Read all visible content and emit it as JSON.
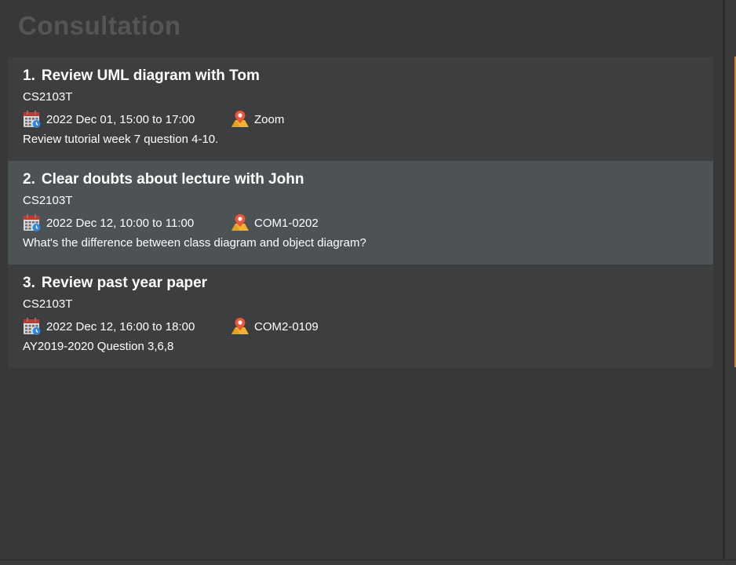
{
  "panel": {
    "title": "Consultation"
  },
  "consultations": [
    {
      "index": "1.",
      "title": "Review UML diagram with Tom",
      "module": "CS2103T",
      "datetime": "2022 Dec 01, 15:00 to 17:00",
      "location": "Zoom",
      "description": "Review tutorial week 7 question 4-10.",
      "selected": false
    },
    {
      "index": "2.",
      "title": "Clear doubts about lecture with John",
      "module": "CS2103T",
      "datetime": "2022 Dec 12, 10:00 to 11:00",
      "location": "COM1-0202",
      "description": "What's the difference between class diagram and object diagram?",
      "selected": true
    },
    {
      "index": "3.",
      "title": "Review past year paper",
      "module": "CS2103T",
      "datetime": "2022 Dec 12, 16:00 to 18:00",
      "location": "COM2-0109",
      "description": "AY2019-2020 Question 3,6,8",
      "selected": false
    }
  ],
  "icons": {
    "calendar": "calendar-icon",
    "location": "location-pin-icon"
  },
  "colors": {
    "background": "#383838",
    "card": "#3c3e3f",
    "card_selected": "#4d5254",
    "title_muted": "#555555",
    "accent": "#d4801e"
  }
}
